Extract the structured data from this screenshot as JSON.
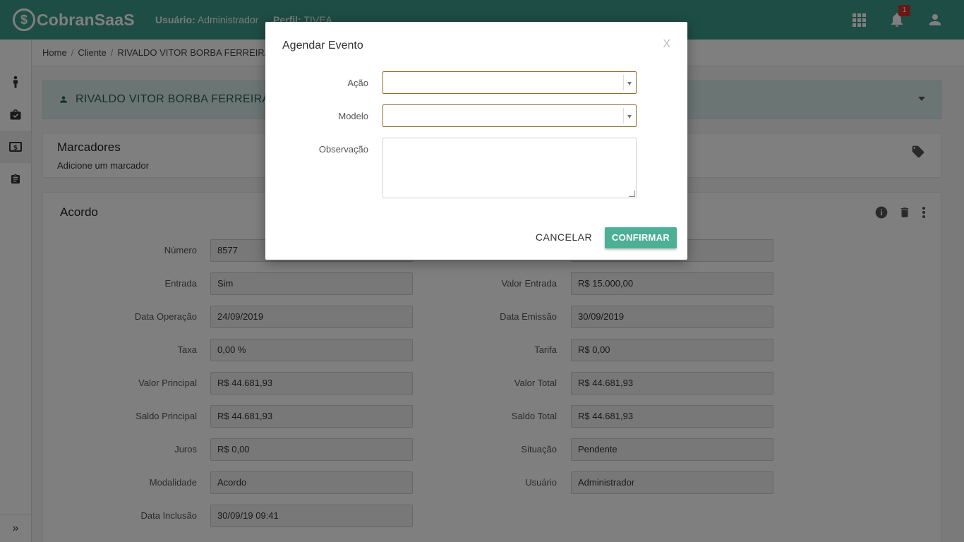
{
  "header": {
    "logo_mark": "$",
    "app_name": "CobranSaaS",
    "user_label": "Usuário:",
    "user_value": "Administrador",
    "profile_label": "Perfil:",
    "profile_value": "TIVEA",
    "notification_count": "1",
    "color": "#3d9a8b"
  },
  "sidebar": {
    "items": [
      "person-icon",
      "briefcase-check-icon",
      "cash-icon",
      "clipboard-icon"
    ],
    "expand_label": "»"
  },
  "breadcrumb": [
    "Home",
    "Cliente",
    "RIVALDO VITOR BORBA FERREIRA"
  ],
  "client": {
    "name": "RIVALDO VITOR BORBA FERREIRA"
  },
  "tags": {
    "title": "Marcadores",
    "subtitle": "Adicione um marcador"
  },
  "agreement": {
    "title": "Acordo",
    "left_fields": [
      {
        "label": "Número",
        "value": "8577"
      },
      {
        "label": "Entrada",
        "value": "Sim"
      },
      {
        "label": "Data Operação",
        "value": "24/09/2019"
      },
      {
        "label": "Taxa",
        "value": "0,00 %"
      },
      {
        "label": "Valor Principal",
        "value": "R$ 44.681,93"
      },
      {
        "label": "Saldo Principal",
        "value": "R$ 44.681,93"
      },
      {
        "label": "Juros",
        "value": "R$ 0,00"
      },
      {
        "label": "Modalidade",
        "value": "Acordo"
      },
      {
        "label": "Data Inclusão",
        "value": "30/09/19 09:41"
      }
    ],
    "right_fields": [
      {
        "label": "",
        "value": ""
      },
      {
        "label": "Valor Entrada",
        "value": "R$ 15.000,00"
      },
      {
        "label": "Data Emissão",
        "value": "30/09/2019"
      },
      {
        "label": "Tarifa",
        "value": "R$ 0,00"
      },
      {
        "label": "Valor Total",
        "value": "R$ 44.681,93"
      },
      {
        "label": "Saldo Total",
        "value": "R$ 44.681,93"
      },
      {
        "label": "Situação",
        "value": "Pendente"
      },
      {
        "label": "Usuário",
        "value": "Administrador"
      }
    ]
  },
  "modal": {
    "title": "Agendar Evento",
    "close_label": "X",
    "action_label": "Ação",
    "action_value": "",
    "model_label": "Modelo",
    "model_value": "",
    "notes_label": "Observação",
    "notes_value": "",
    "cancel_label": "CANCELAR",
    "confirm_label": "CONFIRMAR",
    "confirm_color": "#4caf96"
  }
}
